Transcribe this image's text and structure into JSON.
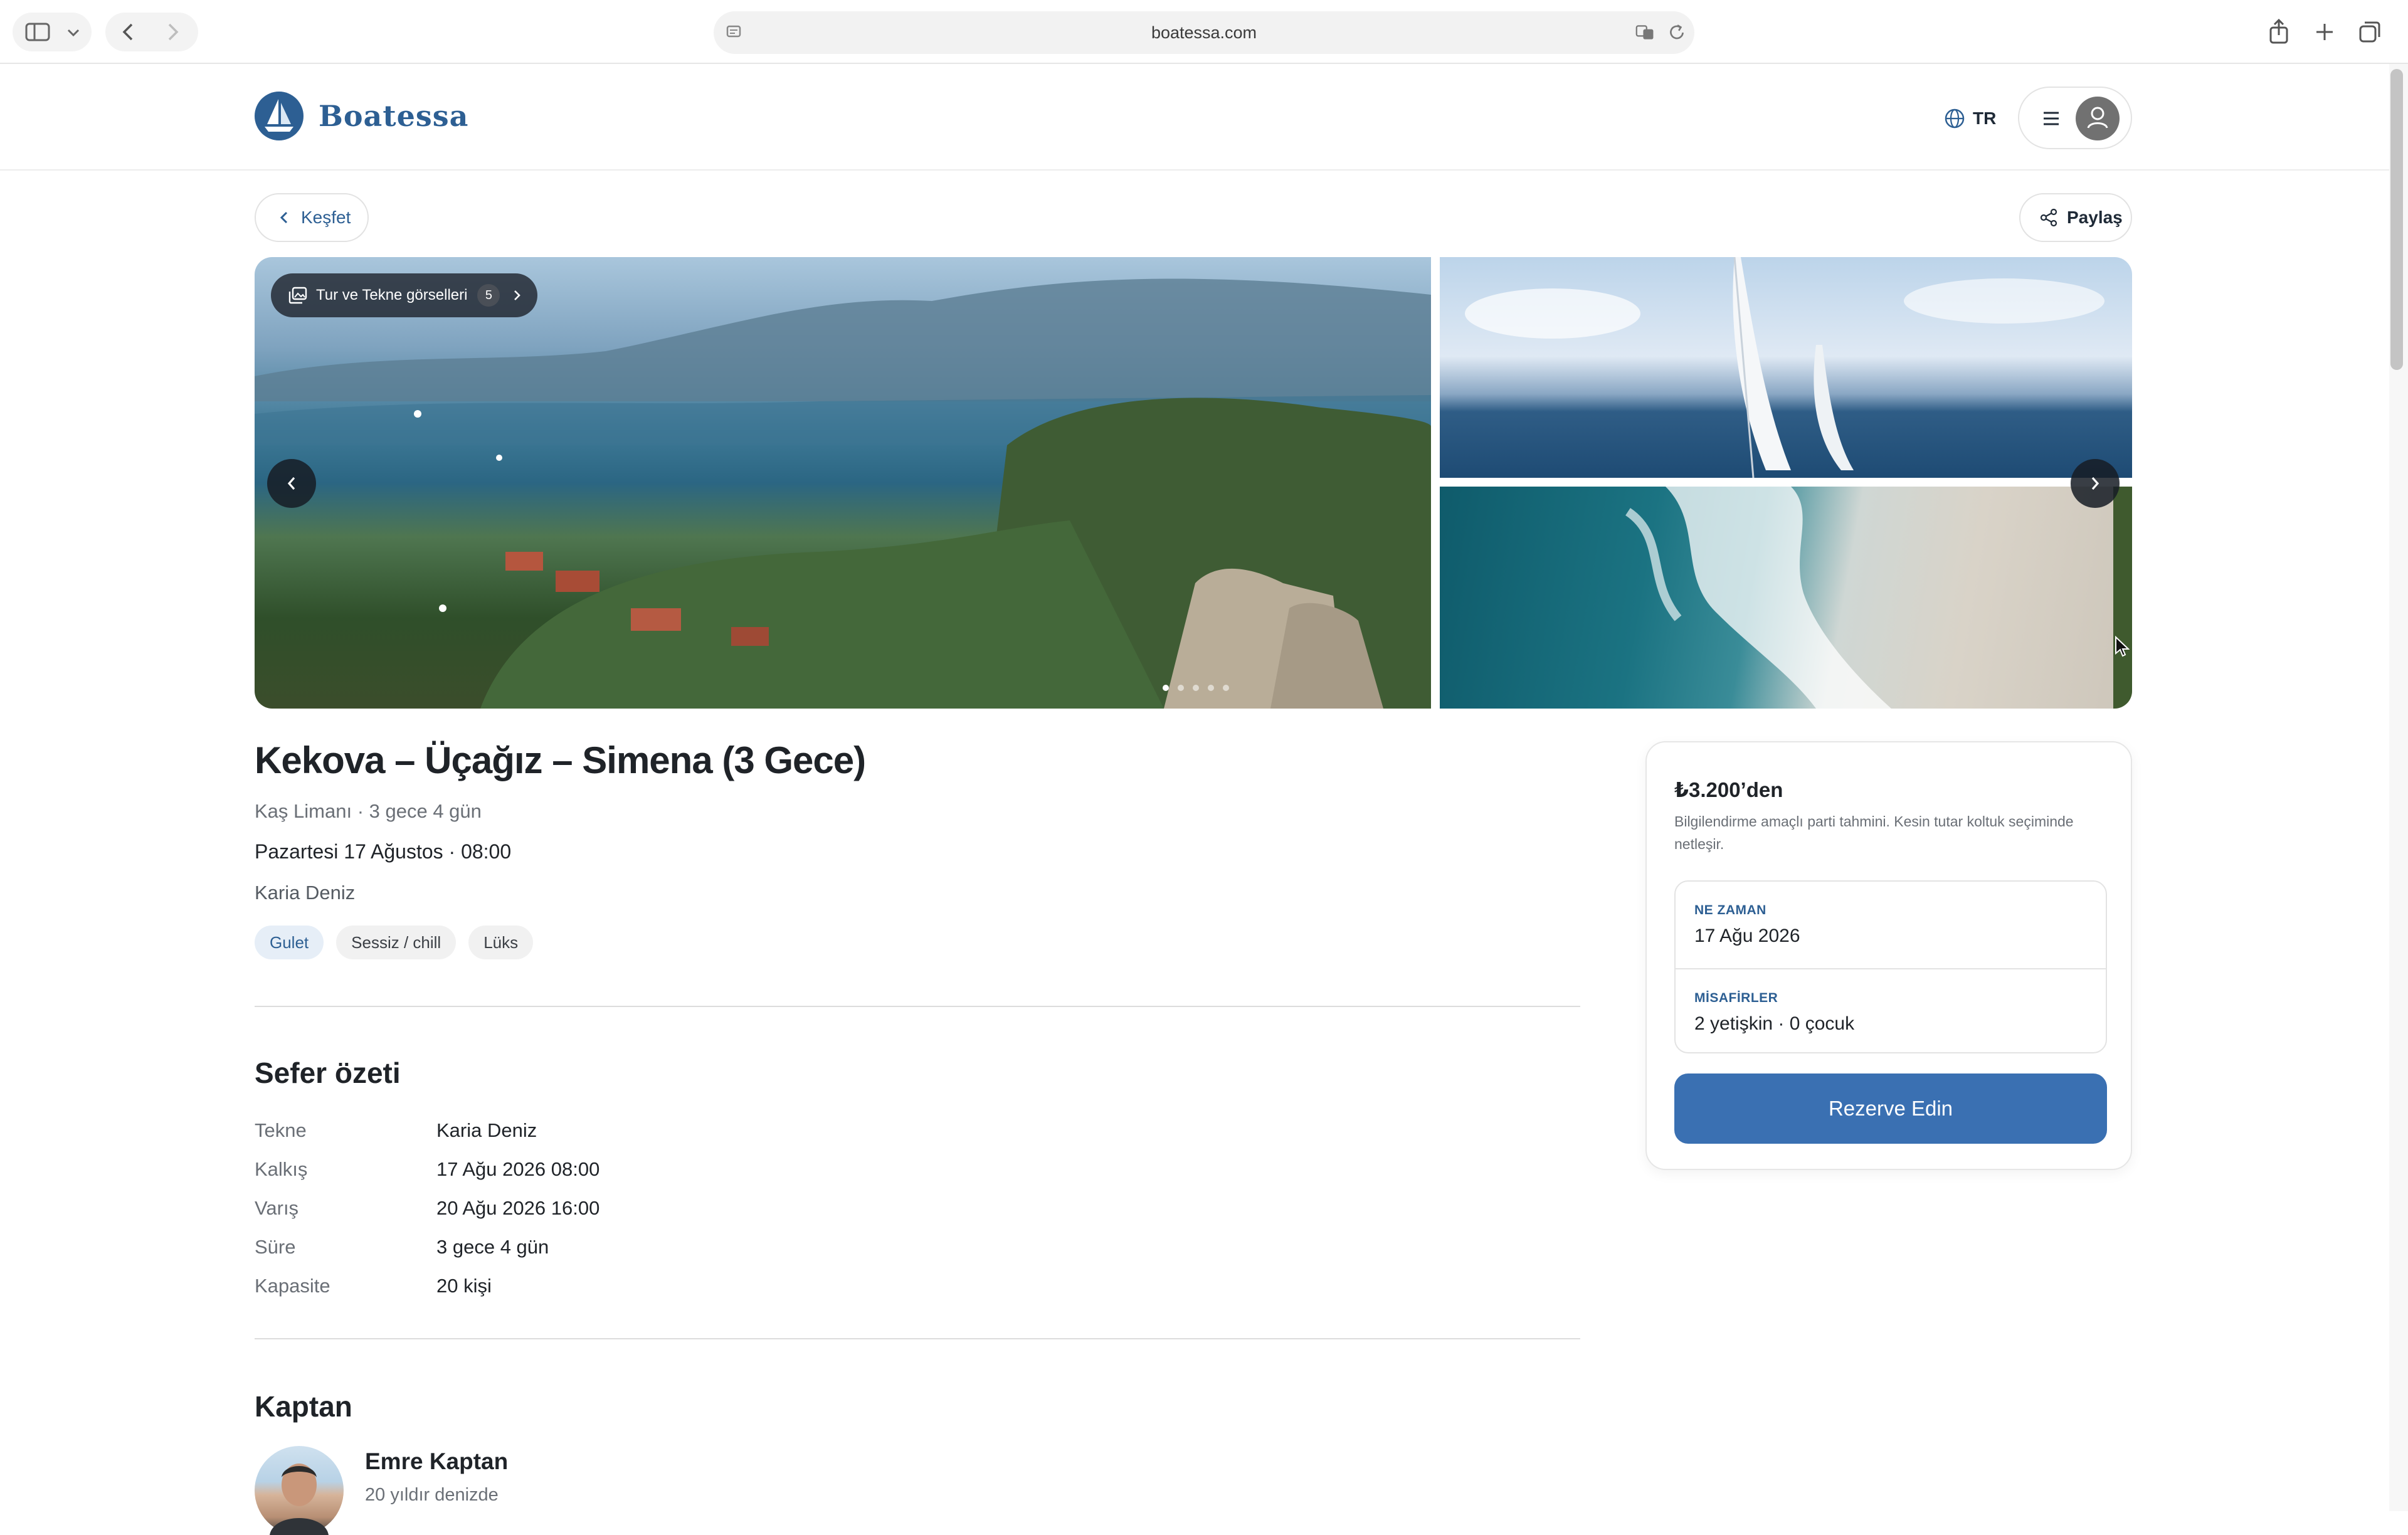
{
  "browser": {
    "url": "boatessa.com"
  },
  "header": {
    "brand": "Boatessa",
    "language": "TR"
  },
  "nav": {
    "back_label": "Keşfet",
    "share_label": "Paylaş"
  },
  "gallery": {
    "chip_label": "Tur ve Tekne görselleri",
    "photo_count": "5",
    "slide_count": 5,
    "active_slide": 0
  },
  "tour": {
    "title": "Kekova – Üçağız – Simena (3 Gece)",
    "location_duration": "Kaş Limanı · 3 gece 4 gün",
    "departure": "Pazartesi 17 Ağustos · 08:00",
    "boat": "Karia Deniz",
    "tags": [
      "Gulet",
      "Sessiz / chill",
      "Lüks"
    ]
  },
  "summary": {
    "title": "Sefer özeti",
    "rows": [
      {
        "key": "Tekne",
        "value": "Karia Deniz"
      },
      {
        "key": "Kalkış",
        "value": "17 Ağu 2026 08:00"
      },
      {
        "key": "Varış",
        "value": "20 Ağu 2026 16:00"
      },
      {
        "key": "Süre",
        "value": "3 gece 4 gün"
      },
      {
        "key": "Kapasite",
        "value": "20 kişi"
      }
    ]
  },
  "captain": {
    "title": "Kaptan",
    "name": "Emre Kaptan",
    "experience": "20 yıldır denizde"
  },
  "booking": {
    "price": "₺3.200’den",
    "note": "Bilgilendirme amaçlı parti tahmini. Kesin tutar koltuk seçiminde netleşir.",
    "when_label": "NE ZAMAN",
    "when_value": "17 Ağu 2026",
    "guests_label": "MİSAFİRLER",
    "guests_value": "2 yetişkin · 0 çocuk",
    "cta": "Rezerve Edin"
  },
  "colors": {
    "brand": "#2d5f93",
    "cta": "#3a70b2"
  }
}
